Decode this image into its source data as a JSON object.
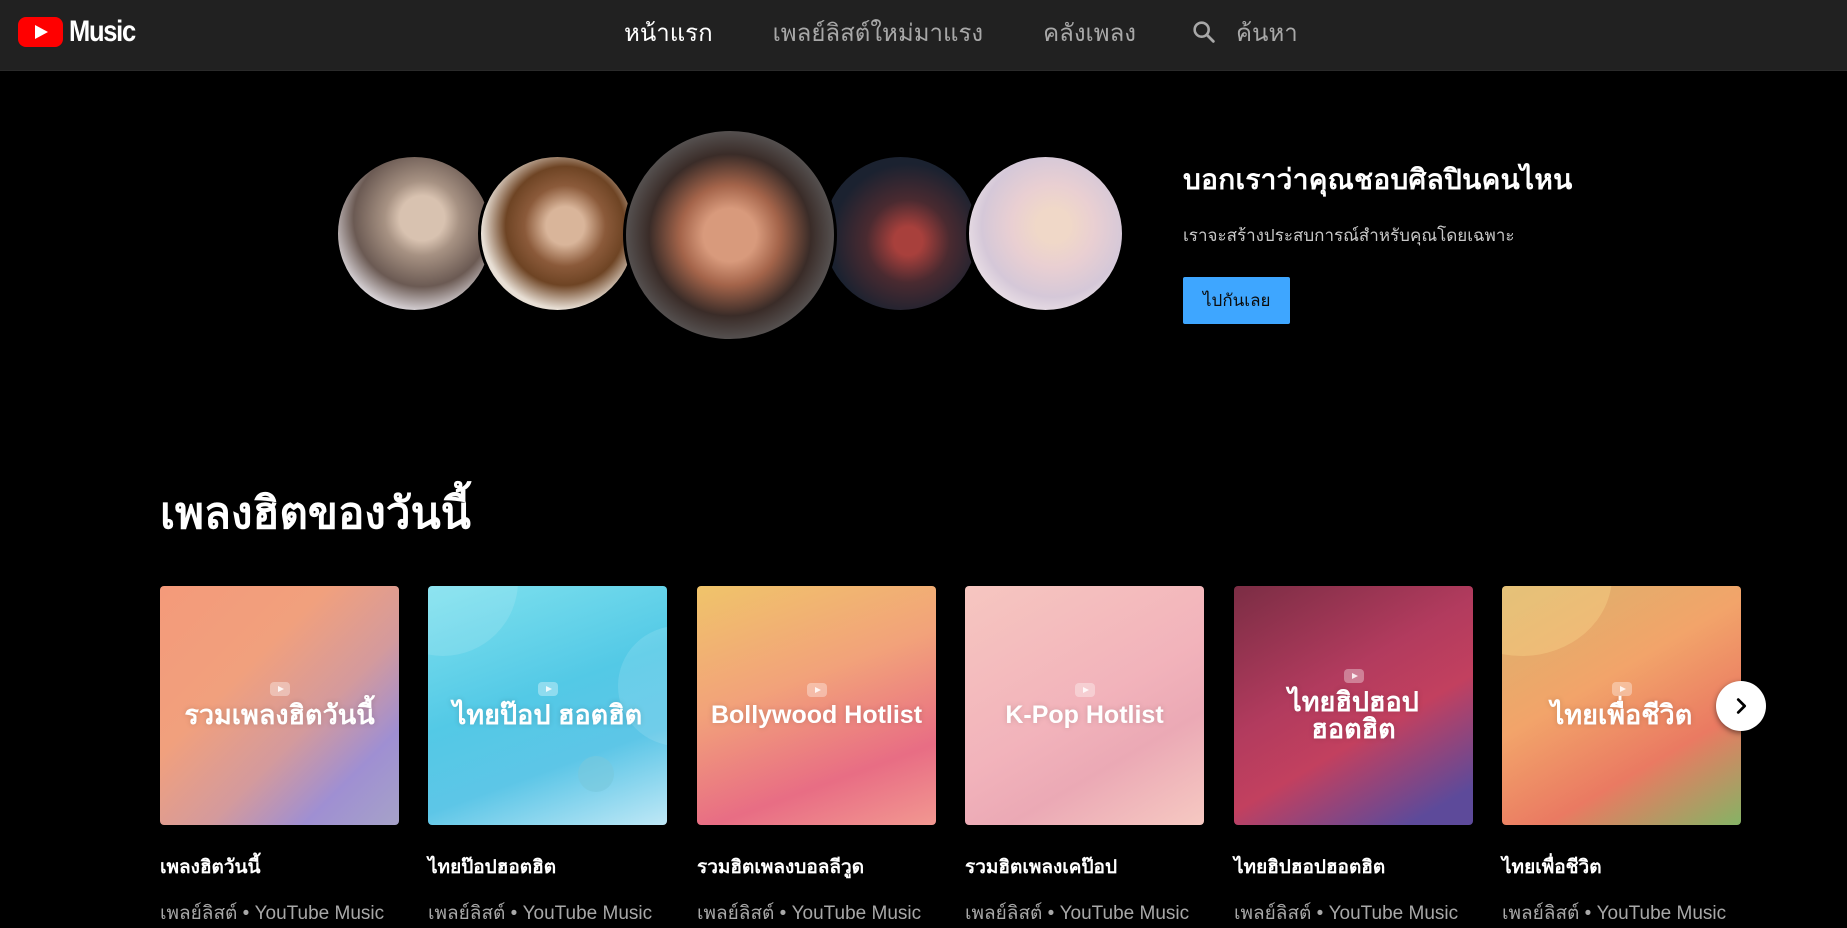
{
  "header": {
    "logo_text": "Music",
    "nav": [
      {
        "label": "หน้าแรก",
        "active": true
      },
      {
        "label": "เพลย์ลิสต์ใหม่มาแรง",
        "active": false
      },
      {
        "label": "คลังเพลง",
        "active": false
      }
    ],
    "search_label": "ค้นหา"
  },
  "hero": {
    "title": "บอกเราว่าคุณชอบศิลปินคนไหน",
    "subtitle": "เราจะสร้างประสบการณ์สำหรับคุณโดยเฉพาะ",
    "button_label": "ไปกันเลย",
    "button_color": "#3ea6ff"
  },
  "section": {
    "title": "เพลงฮิตของวันนี้",
    "cards": [
      {
        "art_title": "รวมเพลงฮิตวันนี้",
        "name": "เพลงฮิตวันนี้",
        "meta": "เพลย์ลิสต์ • YouTube Music"
      },
      {
        "art_title": "ไทยป๊อป ฮอตฮิต",
        "name": "ไทยป๊อปฮอตฮิต",
        "meta": "เพลย์ลิสต์ • YouTube Music"
      },
      {
        "art_title": "Bollywood Hotlist",
        "name": "รวมฮิตเพลงบอลลีวูด",
        "meta": "เพลย์ลิสต์ • YouTube Music"
      },
      {
        "art_title": "K-Pop Hotlist",
        "name": "รวมฮิตเพลงเคป๊อป",
        "meta": "เพลย์ลิสต์ • YouTube Music"
      },
      {
        "art_title": "ไทยฮิปฮอป ฮอตฮิต",
        "name": "ไทยฮิปฮอปฮอตฮิต",
        "meta": "เพลย์ลิสต์ • YouTube Music"
      },
      {
        "art_title": "ไทยเพื่อชีวิต",
        "name": "ไทยเพื่อชีวิต",
        "meta": "เพลย์ลิสต์ • YouTube Music"
      }
    ]
  },
  "colors": {
    "topbar_bg": "#212121",
    "page_bg": "#000000",
    "brand_red": "#ff0000"
  }
}
